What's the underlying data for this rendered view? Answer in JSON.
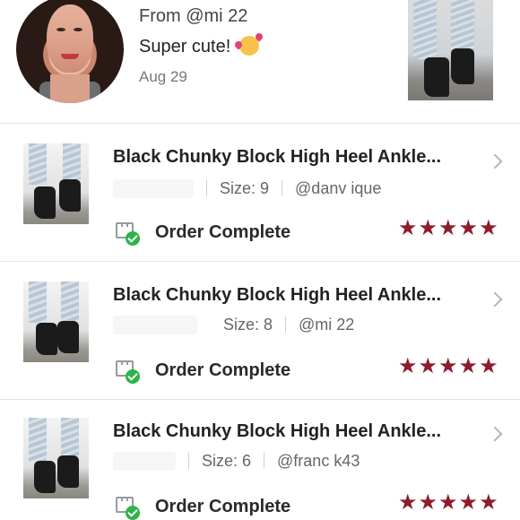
{
  "comment": {
    "from": "From @mi   22",
    "text": "Super cute!",
    "emoji": "smiling-face-with-hearts",
    "date": "Aug 29"
  },
  "orders": [
    {
      "title": "Black Chunky Block High Heel Ankle...",
      "size": "Size: 9",
      "seller": "@danv             ique",
      "status": "Order Complete",
      "rating": 5,
      "stars": "★★★★★"
    },
    {
      "title": "Black Chunky Block High Heel Ankle...",
      "size": "Size: 8",
      "seller": "@mi     22",
      "status": "Order Complete",
      "rating": 5,
      "stars": "★★★★★"
    },
    {
      "title": "Black Chunky Block High Heel Ankle...",
      "size": "Size: 6",
      "seller": "@franc     k43",
      "status": "Order Complete",
      "rating": 5,
      "stars": "★★★★★"
    }
  ],
  "colors": {
    "star": "#8c1d2c",
    "check": "#2eb34a",
    "divider": "#e3e3e3"
  }
}
